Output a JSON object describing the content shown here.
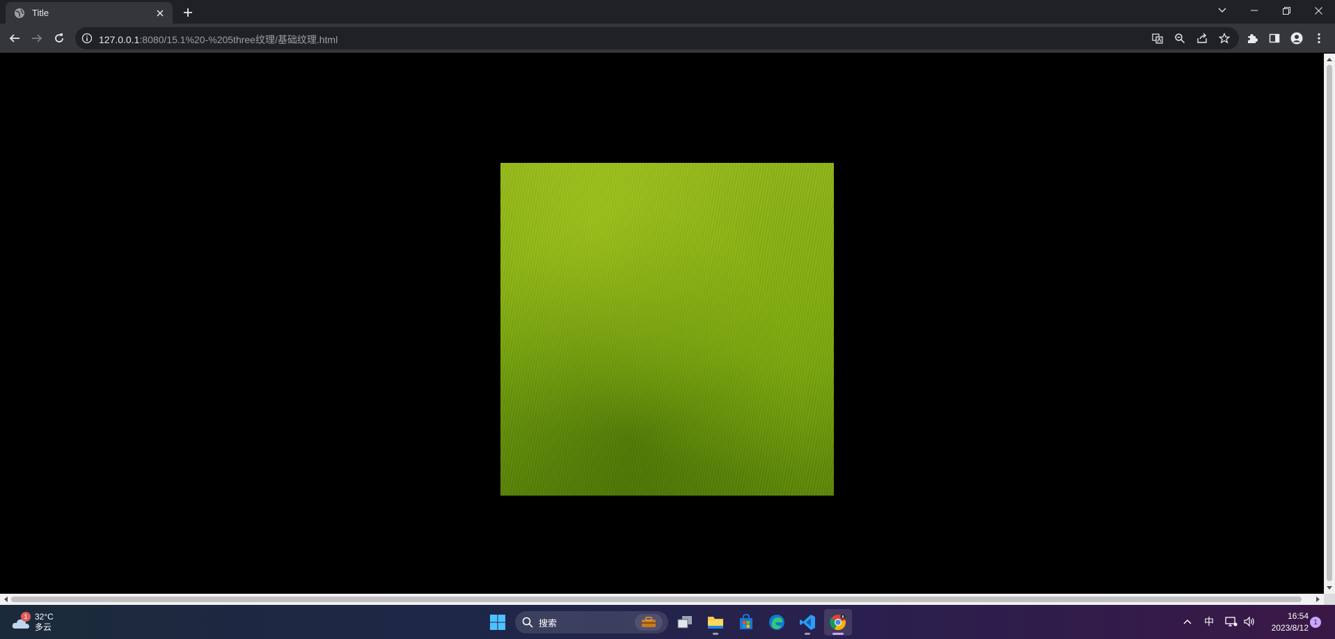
{
  "browser": {
    "tab": {
      "title": "Title",
      "favicon": "globe-icon"
    },
    "address": {
      "host": "127.0.0.1",
      "path": ":8080/15.1%20-%205three纹理/基础纹理.html"
    }
  },
  "page": {
    "texture": "grass",
    "colors": {
      "background": "#000000",
      "grass_light": "#8fb517",
      "grass_dark": "#5b8606"
    }
  },
  "taskbar": {
    "weather": {
      "temp": "32°C",
      "desc": "多云",
      "badge": "1"
    },
    "search": {
      "label": "搜索"
    },
    "tray": {
      "ime": "中"
    },
    "clock": {
      "time": "16:54",
      "date": "2023/8/12"
    },
    "notification_count": "1"
  }
}
